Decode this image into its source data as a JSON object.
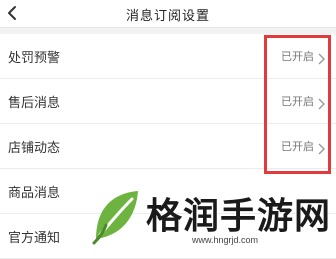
{
  "header": {
    "title": "消息订阅设置",
    "back_icon": "chevron-left-icon"
  },
  "settings": {
    "items": [
      {
        "label": "处罚预警",
        "status": "已开启"
      },
      {
        "label": "售后消息",
        "status": "已开启"
      },
      {
        "label": "店铺动态",
        "status": "已开启"
      },
      {
        "label": "商品消息",
        "status": ""
      },
      {
        "label": "官方通知",
        "status": ""
      }
    ]
  },
  "highlight": {
    "color": "#e33b3b"
  },
  "watermark": {
    "text": "格润手游网",
    "url": "www.hngrjd.com",
    "logo_color": "#6db33f"
  }
}
